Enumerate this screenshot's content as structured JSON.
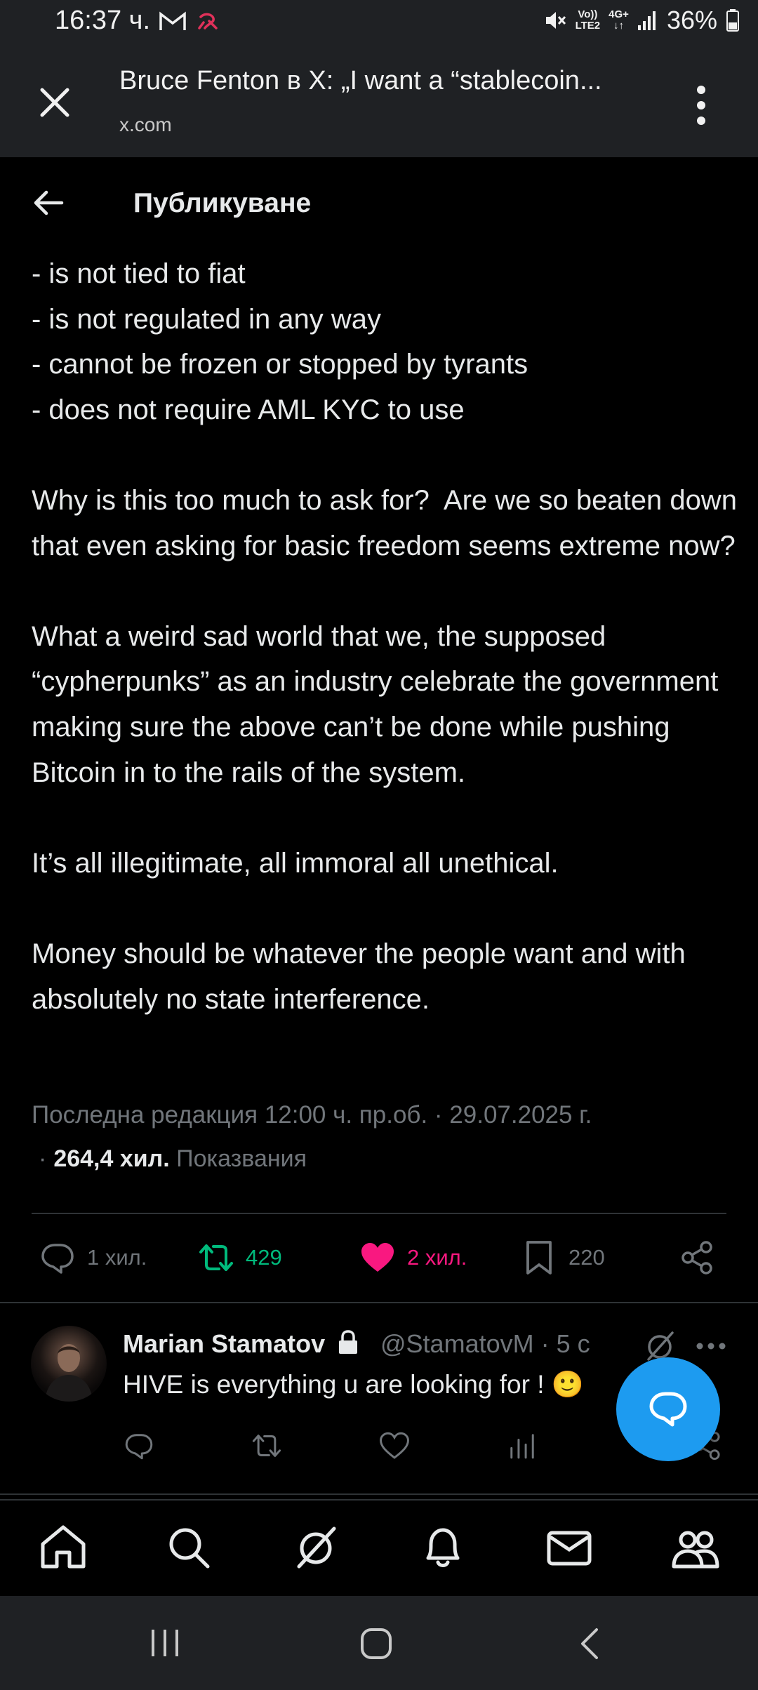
{
  "status_bar": {
    "time": "16:37 ч.",
    "volte_label_top": "Vo))",
    "volte_label_bottom": "LTE2",
    "network_label": "4G+",
    "battery": "36%"
  },
  "browser": {
    "title": "Bruce Fenton в X: „I want a “stablecoin...",
    "url": "x.com"
  },
  "header": {
    "title": "Публикуване"
  },
  "tweet": {
    "body": "- is not tied to fiat\n- is not regulated in any way\n- cannot be frozen or stopped by tyrants\n- does not require AML KYC to use\n\nWhy is this too much to ask for?  Are we so beaten down that even asking for basic freedom seems extreme now?\n\nWhat a weird sad world that we, the supposed “cypherpunks” as an industry celebrate the government making sure the above can’t be done while pushing Bitcoin in to the rails of the system.\n\nIt’s all illegitimate, all immoral all unethical.\n\nMoney should be whatever the people want and with absolutely no state interference.",
    "edited_label": "Последна редакция 12:00 ч. пр.об. · 29.07.2025 г.",
    "views_sep": "·",
    "views_count": "264,4 хил.",
    "views_label": "Показвания",
    "replies": "1 хил.",
    "reposts": "429",
    "likes": "2 хил.",
    "bookmarks": "220",
    "colors": {
      "repost": "#00ba7c",
      "like": "#f91880",
      "muted": "#71767b"
    }
  },
  "reply": {
    "name": "Marian Stamatov",
    "handle_time": "@StamatovM · 5 с",
    "text": "HIVE is everything u are looking for ! 🙂"
  },
  "bottom_nav": {
    "items": [
      "home-icon",
      "search-icon",
      "grok-icon",
      "notifications-icon",
      "messages-icon",
      "communities-icon"
    ]
  }
}
